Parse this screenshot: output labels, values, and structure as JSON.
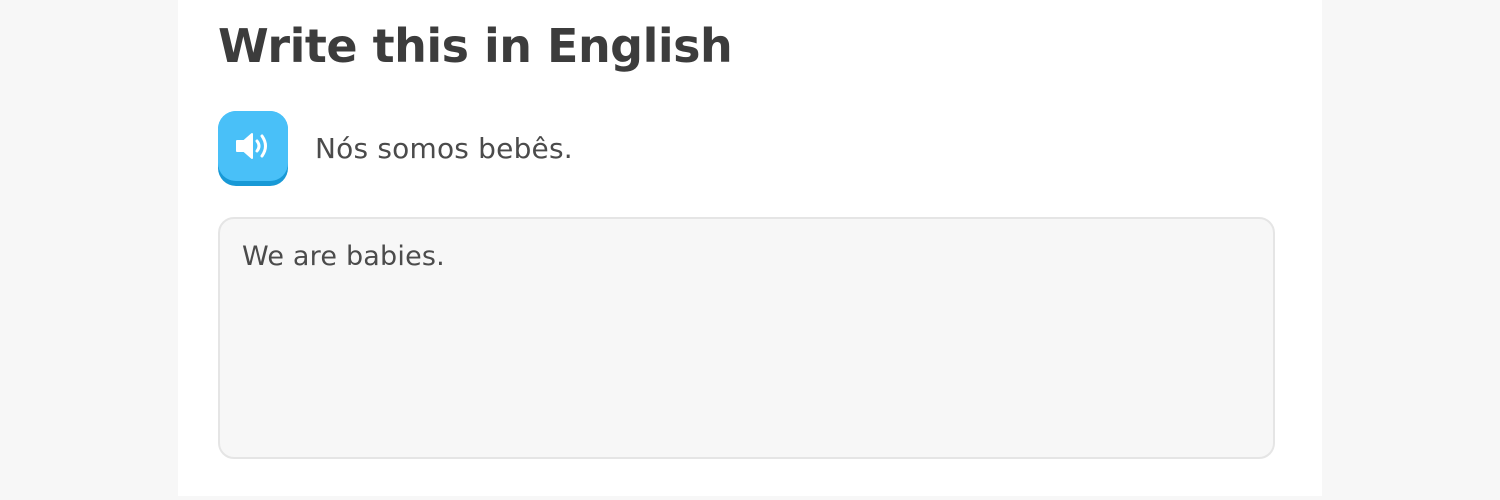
{
  "challenge": {
    "title": "Write this in English",
    "prompt": "Nós somos bebês.",
    "answer_value": "We are babies."
  },
  "icons": {
    "speaker": "speaker-icon"
  },
  "colors": {
    "speaker_button": "#49c0f8",
    "speaker_button_shadow": "#1899d6",
    "title_text": "#3c3c3c",
    "body_text": "#4b4b4b",
    "answer_background": "#f7f7f7",
    "answer_border": "#e5e5e5"
  }
}
